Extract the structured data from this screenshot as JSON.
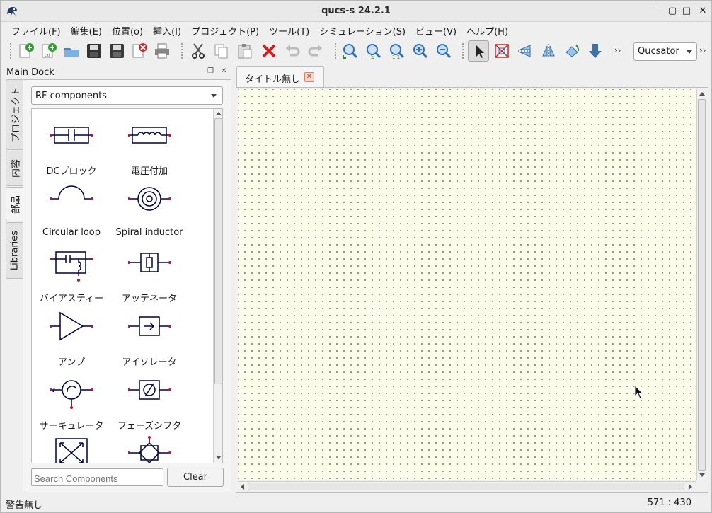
{
  "window": {
    "title": "qucs-s 24.2.1",
    "controls": {
      "minimize": "—",
      "restore": "▢",
      "maximize": "□",
      "close": "✕"
    }
  },
  "menubar": [
    {
      "label": "ファイル(F)"
    },
    {
      "label": "編集(E)"
    },
    {
      "label": "位置(o)"
    },
    {
      "label": "挿入(I)"
    },
    {
      "label": "プロジェクト(P)"
    },
    {
      "label": "ツール(T)"
    },
    {
      "label": "シミュレーション(S)"
    },
    {
      "label": "ビュー(V)"
    },
    {
      "label": "ヘルプ(H)"
    }
  ],
  "toolbar": {
    "icons": [
      "new-schematic-icon",
      "new-text-icon",
      "open-icon",
      "save-icon",
      "save-all-icon",
      "close-document-icon",
      "print-icon",
      "cut-icon",
      "copy-icon",
      "paste-icon",
      "delete-icon",
      "undo-icon",
      "redo-icon",
      "zoom-fit-icon",
      "zoom-selection-icon",
      "zoom-1to1-icon",
      "zoom-in-icon",
      "zoom-out-icon",
      "select-icon",
      "deactivate-icon",
      "mirror-x-icon",
      "mirror-y-icon",
      "rotate-icon",
      "go-into-subcircuit-icon"
    ],
    "overflow": "››",
    "simulator": "Qucsator",
    "overflow2": "››"
  },
  "dock": {
    "title": "Main Dock",
    "tabs": [
      {
        "label": "プロジェクト"
      },
      {
        "label": "内容"
      },
      {
        "label": "部品"
      },
      {
        "label": "Libraries"
      }
    ],
    "category": "RF components",
    "components": [
      {
        "label": "DCブロック",
        "icon": "dc-block-icon"
      },
      {
        "label": "電圧付加",
        "icon": "dc-feed-icon"
      },
      {
        "label": "Circular loop",
        "icon": "circular-loop-icon"
      },
      {
        "label": "Spiral inductor",
        "icon": "spiral-inductor-icon"
      },
      {
        "label": "バイアスティー",
        "icon": "bias-tee-icon"
      },
      {
        "label": "アッテネータ",
        "icon": "attenuator-icon"
      },
      {
        "label": "アンプ",
        "icon": "amplifier-icon"
      },
      {
        "label": "アイソレータ",
        "icon": "isolator-icon"
      },
      {
        "label": "サーキュレータ",
        "icon": "circulator-icon"
      },
      {
        "label": "フェーズシフタ",
        "icon": "phase-shifter-icon"
      },
      {
        "label": "",
        "icon": "coupler-icon"
      },
      {
        "label": "",
        "icon": "hybrid-icon"
      }
    ],
    "search_placeholder": "Search Components",
    "clear_label": "Clear"
  },
  "editor": {
    "tab_label": "タイトル無し",
    "tab_close": "✕"
  },
  "statusbar": {
    "message": "警告無し",
    "coordinates": "571 : 430"
  },
  "colors": {
    "canvas_background": "#fdfdec",
    "component_stroke": "#000040",
    "pin": "#c8102e",
    "tab_close_accent": "#d9826a"
  }
}
